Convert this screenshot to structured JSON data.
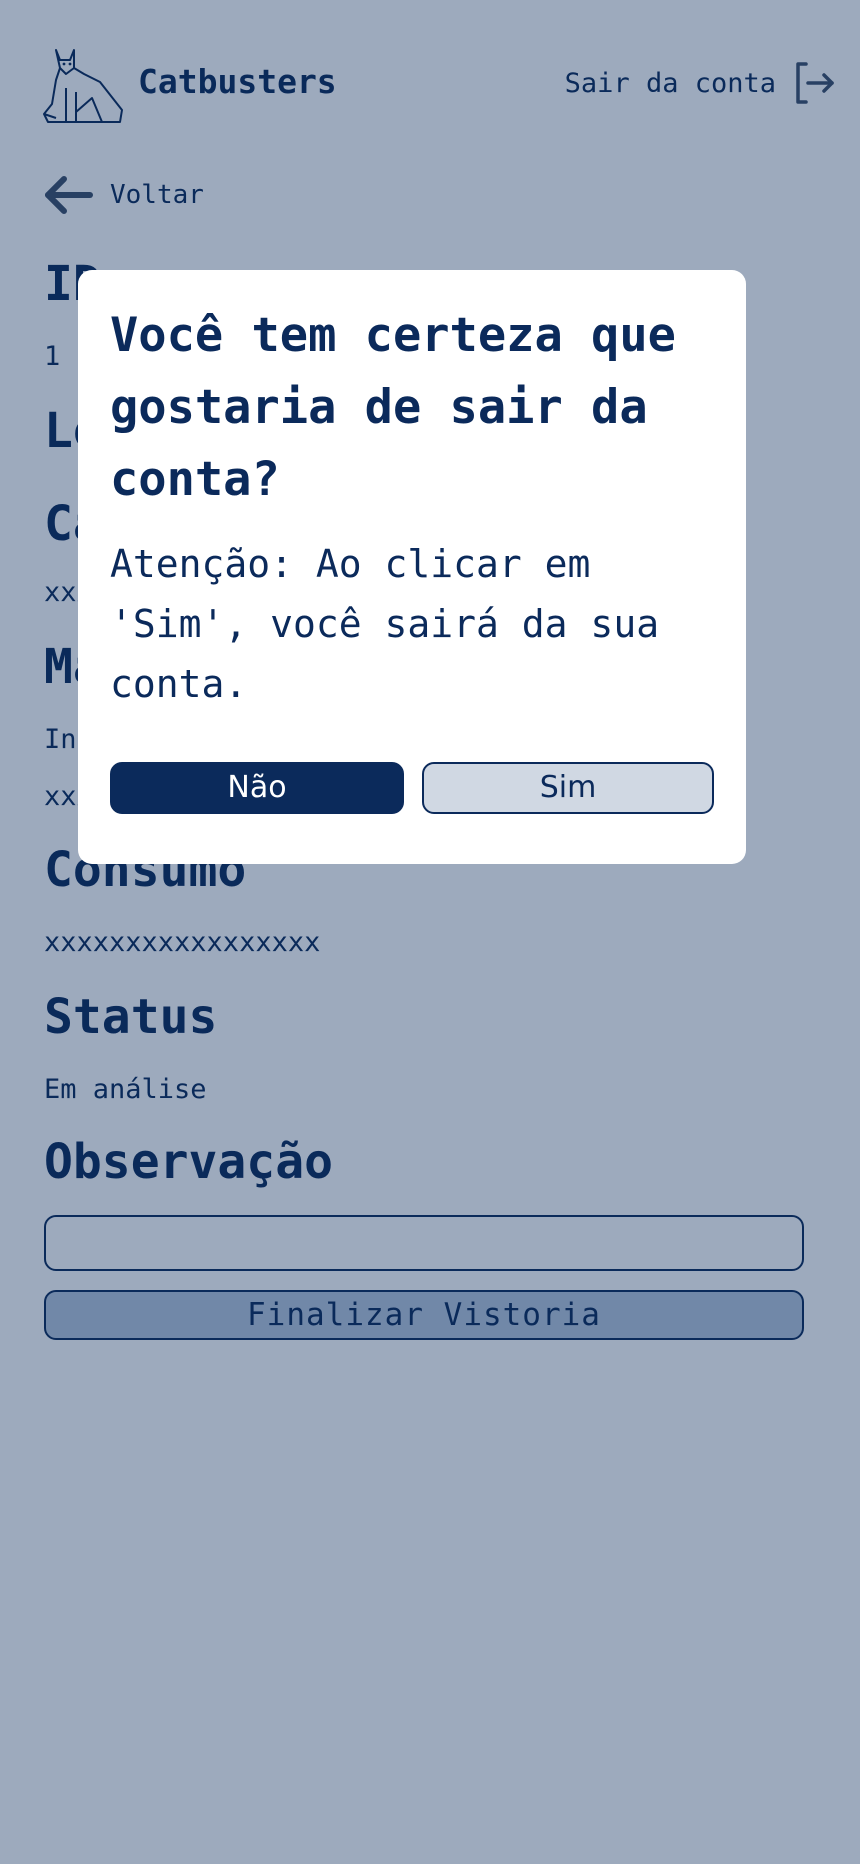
{
  "header": {
    "brand": "Catbusters",
    "logout_label": "Sair da conta",
    "logo_icon": "cat-logo-icon",
    "logout_icon": "logout-arrow-icon"
  },
  "nav": {
    "back_label": "Voltar",
    "back_icon": "arrow-left-icon"
  },
  "details": {
    "id_title": "ID",
    "id_value": "1",
    "local_title": "Local",
    "ca_title": "Casa",
    "ca_value": "xxxxxxxxxxxxxxxxx",
    "ma_title": "Marca",
    "ma_value_1": "Info",
    "ma_value_2": "xxxxxxxxxxxxxxxxx",
    "consumo_title": "Consumo",
    "consumo_value": "xxxxxxxxxxxxxxxxx",
    "status_title": "Status",
    "status_value": "Em análise",
    "observacao_title": "Observação",
    "observacao_value": "",
    "finish_label": "Finalizar Vistoria"
  },
  "modal": {
    "title": "Você tem certeza que gostaria de sair da conta?",
    "text": "Atenção: Ao clicar em 'Sim', você sairá da sua conta.",
    "no_label": "Não",
    "yes_label": "Sim"
  },
  "colors": {
    "primary": "#0b2a5b",
    "overlay": "rgba(11,42,91,0.40)",
    "secondary_button": "#d0d8e3",
    "modal_background": "#ffffff"
  }
}
